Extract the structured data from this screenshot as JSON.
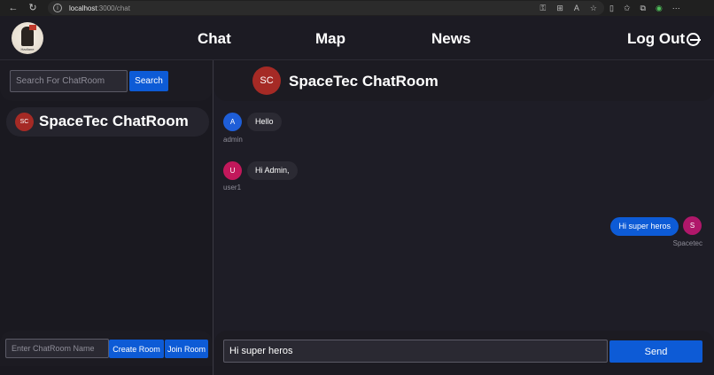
{
  "browser": {
    "url_host": "localhost",
    "url_path": ":3000/chat"
  },
  "header": {
    "logo_text": "Hadlane",
    "nav": [
      "Chat",
      "Map",
      "News"
    ],
    "logout_label": "Log Out"
  },
  "sidebar": {
    "search_placeholder": "Search For ChatRoom",
    "search_button": "Search",
    "rooms": [
      {
        "initials": "SC",
        "name": "SpaceTec ChatRoom"
      }
    ],
    "room_name_placeholder": "Enter ChatRoom Name",
    "create_button": "Create Room",
    "join_button": "Join Room"
  },
  "chat": {
    "room_initials": "SC",
    "room_title": "SpaceTec ChatRoom",
    "messages": [
      {
        "initial": "A",
        "text": "Hello",
        "sender": "admin",
        "direction": "incoming",
        "avatar_color": "#1e5ed8"
      },
      {
        "initial": "U",
        "text": "Hi Admin,",
        "sender": "user1",
        "direction": "incoming",
        "avatar_color": "#c2185b"
      },
      {
        "initial": "S",
        "text": "Hi super heros",
        "sender": "Spacetec",
        "direction": "outgoing",
        "avatar_color": "#b0176a"
      }
    ],
    "input_value": "Hi super heros",
    "send_button": "Send"
  },
  "colors": {
    "accent": "#0d5bd6",
    "room_avatar": "#a52a25",
    "background": "#1e1d26"
  }
}
